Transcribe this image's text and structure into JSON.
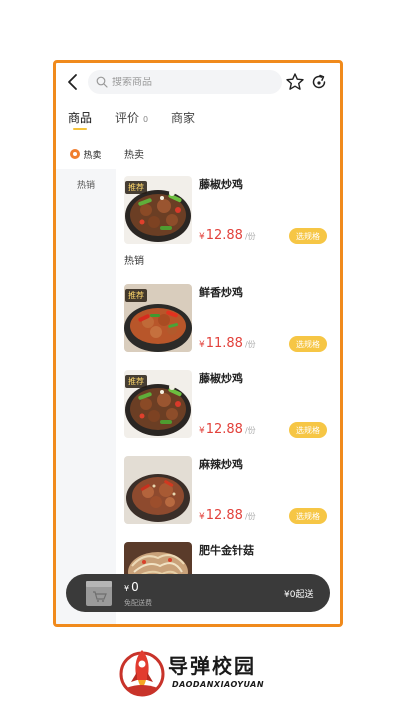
{
  "search": {
    "placeholder": "搜索商品"
  },
  "tabs": [
    {
      "label": "商品"
    },
    {
      "label": "评价",
      "count": "0"
    },
    {
      "label": "商家"
    }
  ],
  "categories": [
    {
      "label": "热卖"
    },
    {
      "label": "热销"
    }
  ],
  "sections": [
    {
      "title": "热卖"
    },
    {
      "title": "热销"
    }
  ],
  "items": [
    {
      "tag": "推荐",
      "name": "藤椒炒鸡",
      "currency": "¥",
      "price": "12.88",
      "unit": "/份",
      "button": "选规格"
    },
    {
      "tag": "推荐",
      "name": "鲜香炒鸡",
      "currency": "¥",
      "price": "11.88",
      "unit": "/份",
      "button": "选规格"
    },
    {
      "tag": "推荐",
      "name": "藤椒炒鸡",
      "currency": "¥",
      "price": "12.88",
      "unit": "/份",
      "button": "选规格"
    },
    {
      "tag": "",
      "name": "麻辣炒鸡",
      "currency": "¥",
      "price": "12.88",
      "unit": "/份",
      "button": "选规格"
    },
    {
      "tag": "",
      "name": "肥牛金针菇"
    }
  ],
  "cart": {
    "currency": "¥",
    "total": "0",
    "fee_text": "免配送费",
    "min_order": "¥0起送"
  },
  "logo": {
    "name_cn": "导弹校园",
    "name_en": "DAODANXIAOYUAN"
  },
  "colors": {
    "accent": "#f08a1c",
    "price": "#e2423c",
    "button": "#f6c645"
  }
}
